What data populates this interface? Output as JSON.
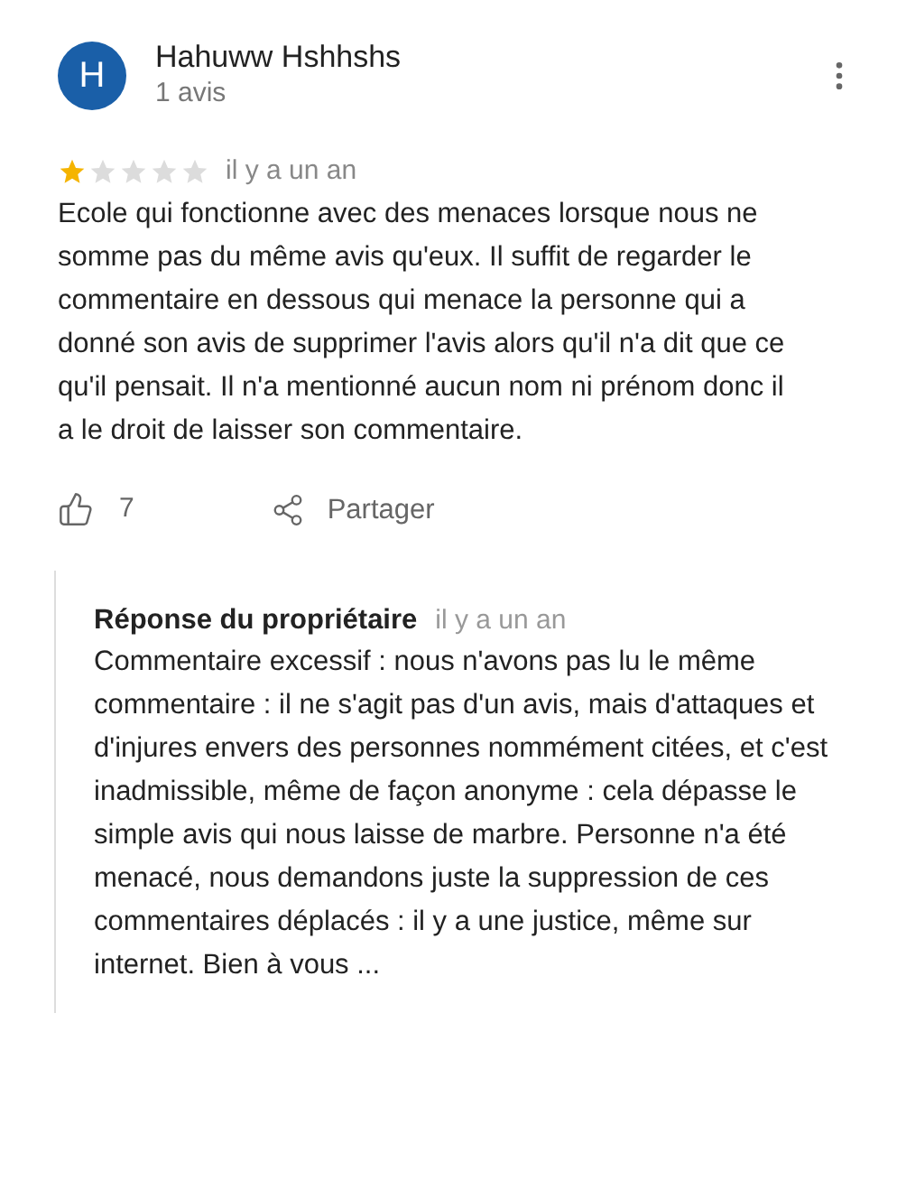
{
  "reviewer": {
    "initial": "H",
    "name": "Hahuww Hshhshs",
    "review_count": "1 avis"
  },
  "review": {
    "stars": 1,
    "time": "il y a un an",
    "text": "Ecole qui fonctionne avec des menaces lorsque nous ne somme pas du même avis qu'eux. Il suffit de regarder le commentaire en dessous qui menace la personne qui a donné son avis de supprimer l'avis alors qu'il n'a dit que ce qu'il pensait. Il n'a mentionné aucun nom ni prénom donc il a le droit de laisser son commentaire."
  },
  "actions": {
    "likes": "7",
    "share": "Partager"
  },
  "owner_reply": {
    "title": "Réponse du propriétaire",
    "time": "il y a un an",
    "text": "Commentaire excessif : nous n'avons pas lu le même commentaire : il ne s'agit pas d'un avis, mais d'attaques et d'injures envers des personnes nommément citées, et c'est inadmissible, même de façon anonyme : cela dépasse le simple avis qui nous laisse de marbre. Personne n'a été menacé, nous demandons juste la suppression de ces commentaires déplacés : il y a une justice, même sur internet. Bien à vous ..."
  }
}
